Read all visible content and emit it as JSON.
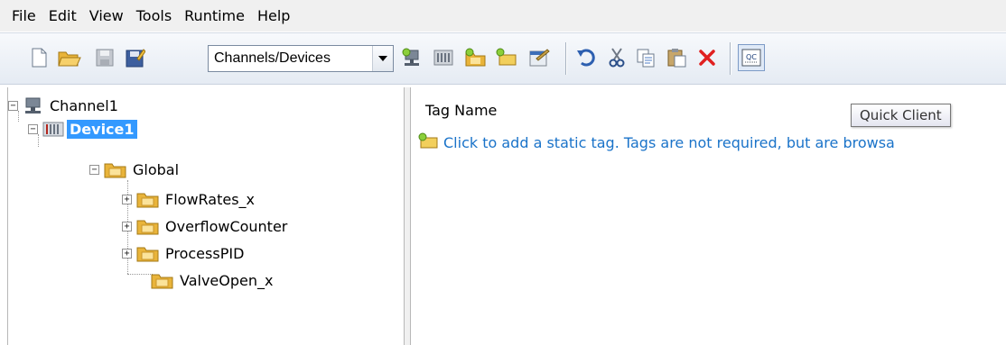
{
  "menu": [
    "File",
    "Edit",
    "View",
    "Tools",
    "Runtime",
    "Help"
  ],
  "toolbar": {
    "view_selector": "Channels/Devices",
    "quick_client_badge": "QC",
    "icons": [
      "new-icon",
      "open-icon",
      "save-icon",
      "save-as-icon",
      "new-channel-icon",
      "new-device-icon",
      "new-tag-group-icon",
      "new-tag-icon",
      "properties-icon",
      "undo-icon",
      "cut-icon",
      "copy-icon",
      "paste-icon",
      "delete-icon",
      "quick-client-icon"
    ]
  },
  "tree": {
    "channel": "Channel1",
    "device": "Device1",
    "group": "Global",
    "children": [
      "FlowRates_x",
      "OverflowCounter",
      "ProcessPID",
      "ValveOpen_x"
    ]
  },
  "tag_pane": {
    "column_header": "Tag Name",
    "add_hint": "Click to add a static tag.  Tags are not required, but are browsa"
  },
  "tooltip": "Quick Client",
  "colors": {
    "selection": "#3399ff",
    "link": "#1a73c9",
    "delete": "#e02020"
  }
}
